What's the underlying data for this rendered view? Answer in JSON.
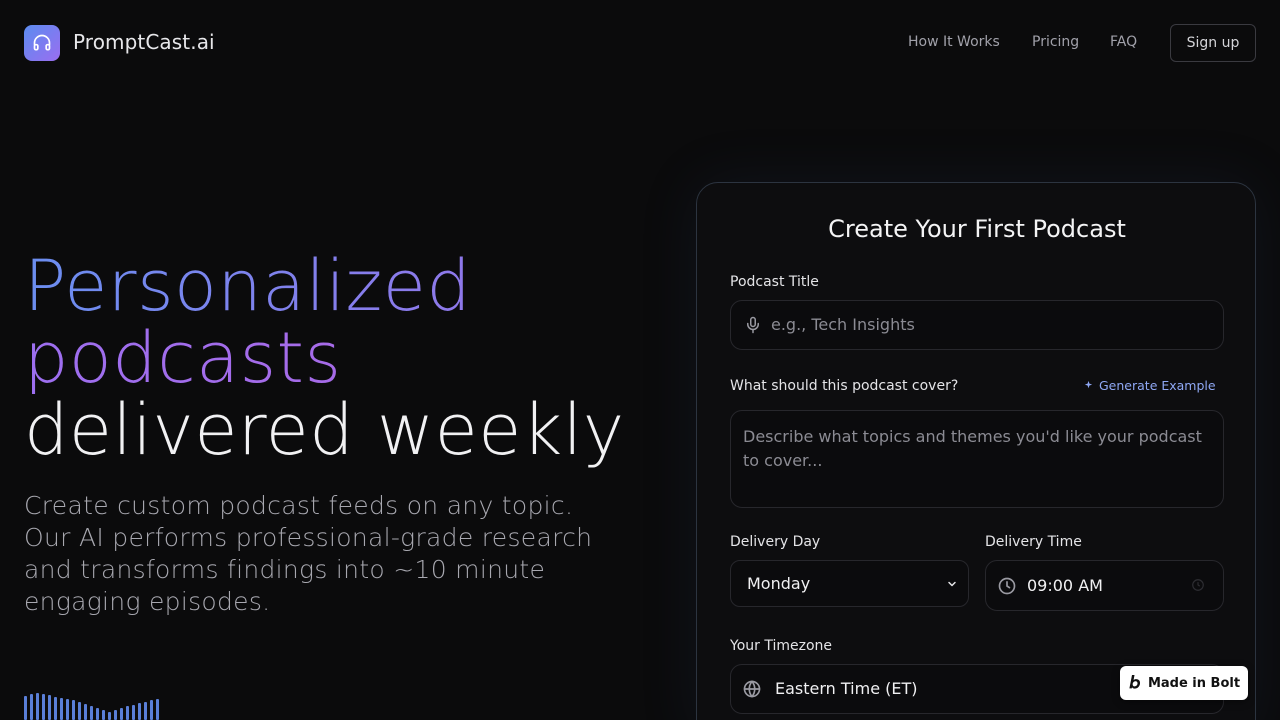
{
  "brand": {
    "name": "PromptCast.ai",
    "logo_icon": "headphones-icon",
    "logo_gradient": [
      "#5b8cf0",
      "#9a6ef0"
    ]
  },
  "nav": {
    "how_it_works": "How It Works",
    "pricing": "Pricing",
    "faq": "FAQ",
    "signup": "Sign up"
  },
  "hero": {
    "line1": "Personalized",
    "line2": "podcasts",
    "line3": "delivered weekly",
    "subtitle": "Create custom podcast feeds on any topic. Our AI performs professional-grade research and transforms findings into ~10 minute engaging episodes."
  },
  "form": {
    "title": "Create Your First Podcast",
    "podcast_title_label": "Podcast Title",
    "podcast_title_placeholder": "e.g., Tech Insights",
    "cover_label": "What should this podcast cover?",
    "generate_example": "Generate Example",
    "cover_placeholder": "Describe what topics and themes you'd like your podcast to cover...",
    "delivery_day_label": "Delivery Day",
    "delivery_day_value": "Monday",
    "delivery_time_label": "Delivery Time",
    "delivery_time_value": "09:00 AM",
    "timezone_label": "Your Timezone",
    "timezone_value": "Eastern Time (ET)"
  },
  "badge": {
    "label": "Made in Bolt"
  },
  "colors": {
    "accent_blue": "#6b8ef0",
    "accent_purple": "#9d6ff0",
    "background": "#0b0b0c"
  }
}
